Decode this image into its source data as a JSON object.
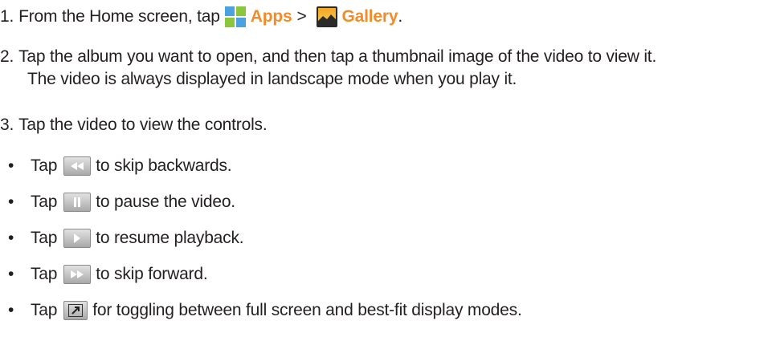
{
  "step1": {
    "number": "1.",
    "text_before": "From the Home screen, tap",
    "apps_label": "Apps",
    "separator": ">",
    "gallery_label": "Gallery",
    "end": "."
  },
  "step2": {
    "number": "2.",
    "line1": "Tap the album you want to open, and then tap a thumbnail image of the video to view it.",
    "line2": "The video is always displayed in landscape mode when you play it."
  },
  "step3": {
    "number": "3.",
    "text": "Tap the video to view the controls."
  },
  "bullets": [
    {
      "bullet": "•",
      "tap": "Tap",
      "icon": "rewind-icon",
      "text": "to skip backwards."
    },
    {
      "bullet": "•",
      "tap": "Tap",
      "icon": "pause-icon",
      "text": "to pause the video."
    },
    {
      "bullet": "•",
      "tap": "Tap",
      "icon": "play-icon",
      "text": "to resume playback."
    },
    {
      "bullet": "•",
      "tap": "Tap",
      "icon": "fast-forward-icon",
      "text": "to skip forward."
    },
    {
      "bullet": "•",
      "tap": "Tap",
      "icon": "fullscreen-toggle-icon",
      "text": "for toggling between full screen and best-fit display modes."
    }
  ],
  "colors": {
    "accent": "#f28c28",
    "text": "#231f20"
  }
}
